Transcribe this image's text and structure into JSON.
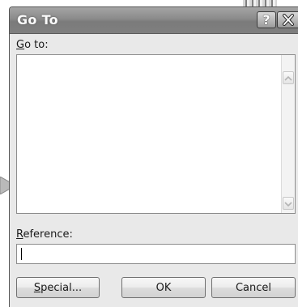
{
  "dialog": {
    "title": "Go To",
    "goto_label": {
      "mnemonic": "G",
      "rest": "o to:"
    },
    "goto_list": {
      "items": []
    },
    "reference_label": {
      "mnemonic": "R",
      "rest": "eference:"
    },
    "reference_input": {
      "value": ""
    },
    "buttons": {
      "special": {
        "mnemonic": "S",
        "rest": "pecial..."
      },
      "ok": "OK",
      "cancel": "Cancel"
    }
  },
  "titlebar_buttons": {
    "help_glyph": "?"
  },
  "icons": {
    "help": "help-icon",
    "close": "close-icon",
    "scroll_up": "chevron-up-icon",
    "scroll_down": "chevron-down-icon"
  },
  "colors": {
    "titlebar": "#8a8a8a",
    "dialog_bg": "#e9e9e9",
    "field_bg": "#ffffff",
    "border": "#707070"
  }
}
